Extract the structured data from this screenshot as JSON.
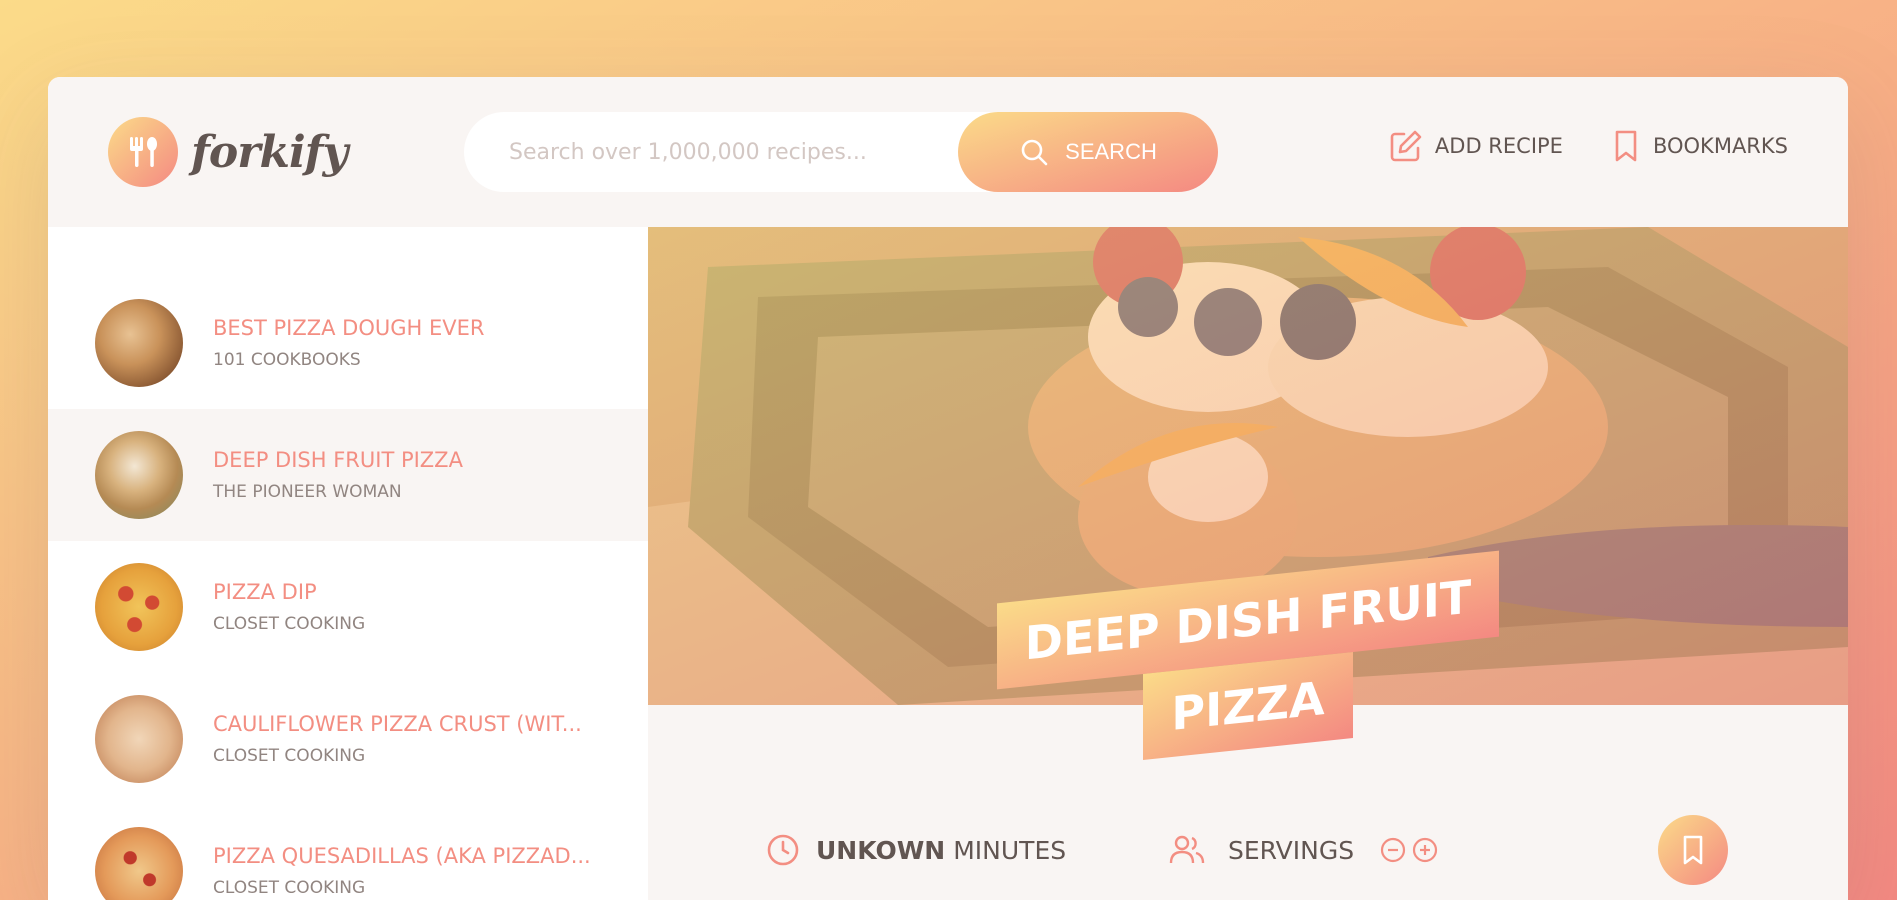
{
  "brand": {
    "name": "forkify"
  },
  "search": {
    "placeholder": "Search over 1,000,000 recipes...",
    "button_label": "SEARCH"
  },
  "nav": {
    "add_recipe": "ADD RECIPE",
    "bookmarks": "BOOKMARKS"
  },
  "results": [
    {
      "title": "BEST PIZZA DOUGH EVER",
      "publisher": "101 COOKBOOKS",
      "active": false
    },
    {
      "title": "DEEP DISH FRUIT PIZZA",
      "publisher": "THE PIONEER WOMAN",
      "active": true
    },
    {
      "title": "PIZZA DIP",
      "publisher": "CLOSET COOKING",
      "active": false
    },
    {
      "title": "CAULIFLOWER PIZZA CRUST (WIT...",
      "publisher": "CLOSET COOKING",
      "active": false
    },
    {
      "title": "PIZZA QUESADILLAS (AKA PIZZAD...",
      "publisher": "CLOSET COOKING",
      "active": false
    }
  ],
  "recipe": {
    "title_line1": "DEEP DISH FRUIT",
    "title_line2": "PIZZA",
    "time_value": "UNKOWN",
    "time_unit": "MINUTES",
    "servings_label": "SERVINGS"
  },
  "icons": [
    "fork-spoon-icon",
    "search-icon",
    "edit-icon",
    "bookmark-icon",
    "clock-icon",
    "users-icon",
    "minus-circle-icon",
    "plus-circle-icon"
  ],
  "colors": {
    "accent_start": "#fbdb89",
    "accent_end": "#f48982",
    "text": "#615551",
    "title": "#f38e82",
    "light_bg": "#f9f5f3"
  }
}
